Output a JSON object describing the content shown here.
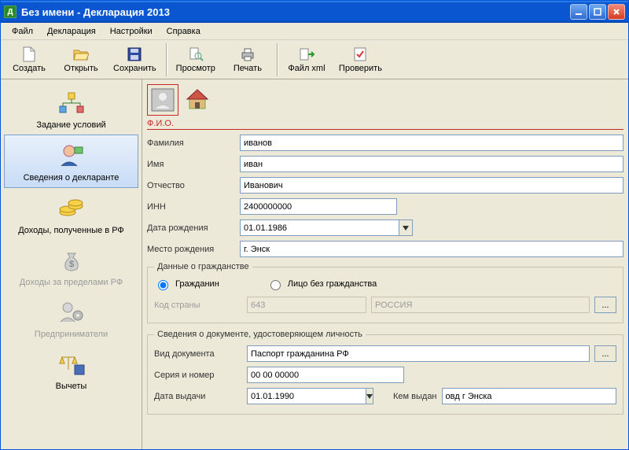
{
  "window": {
    "title": "Без имени - Декларация 2013"
  },
  "menu": {
    "file": "Файл",
    "declaration": "Декларация",
    "settings": "Настройки",
    "help": "Справка"
  },
  "toolbar": {
    "create": "Создать",
    "open": "Открыть",
    "save": "Сохранить",
    "preview": "Просмотр",
    "print": "Печать",
    "filexml": "Файл xml",
    "check": "Проверить"
  },
  "sidebar": {
    "items": [
      {
        "key": "conditions",
        "label": "Задание условий"
      },
      {
        "key": "declarant",
        "label": "Сведения о декларанте"
      },
      {
        "key": "income_rf",
        "label": "Доходы, полученные в РФ"
      },
      {
        "key": "income_abroad",
        "label": "Доходы за пределами РФ"
      },
      {
        "key": "entrepreneurs",
        "label": "Предприниматели"
      },
      {
        "key": "deductions",
        "label": "Вычеты"
      }
    ]
  },
  "section": {
    "fio_header": "Ф.И.О.",
    "labels": {
      "surname": "Фамилия",
      "name": "Имя",
      "patronymic": "Отчество",
      "inn": "ИНН",
      "birthdate": "Дата рождения",
      "birthplace": "Место рождения"
    },
    "values": {
      "surname": "иванов",
      "name": "иван",
      "patronymic": "Иванович",
      "inn": "2400000000",
      "birthdate": "01.01.1986",
      "birthplace": "г. Энск"
    }
  },
  "citizenship": {
    "group_title": "Данные о гражданстве",
    "option_citizen": "Гражданин",
    "option_stateless": "Лицо без гражданства",
    "selected": "citizen",
    "code_label": "Код страны",
    "code_value": "643",
    "country_value": "РОССИЯ"
  },
  "iddoc": {
    "group_title": "Сведения о документе, удостоверяющем личность",
    "labels": {
      "doc_type": "Вид документа",
      "series_number": "Серия и номер",
      "issue_date": "Дата выдачи",
      "issued_by": "Кем выдан"
    },
    "values": {
      "doc_type": "Паспорт гражданина РФ",
      "series_number": "00 00 00000",
      "issue_date": "01.01.1990",
      "issued_by": "овд г Энска"
    }
  }
}
